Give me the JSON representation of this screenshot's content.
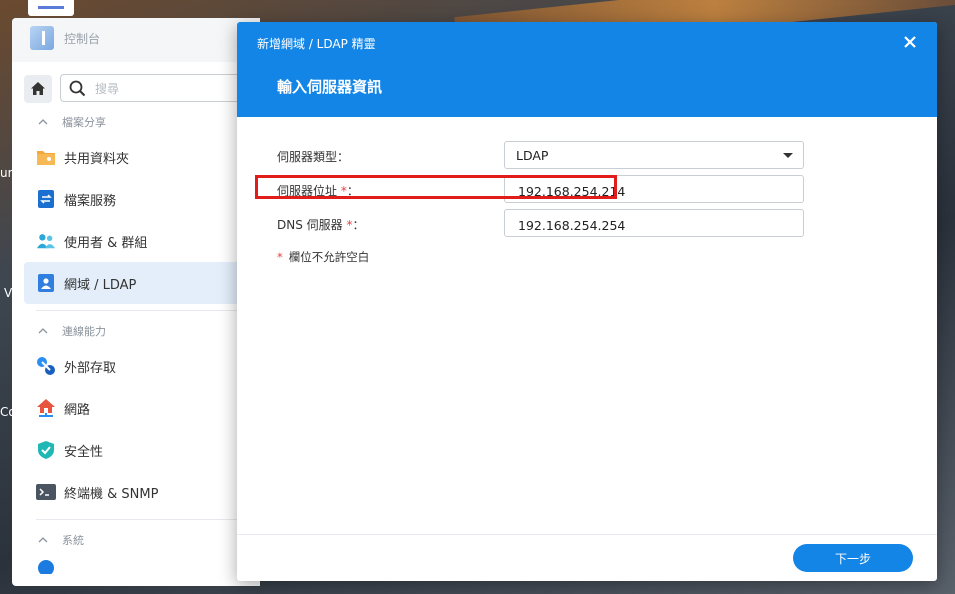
{
  "desktop": {
    "side_labels": [
      "un",
      "V",
      "Co"
    ]
  },
  "control_panel": {
    "title": "控制台",
    "search_placeholder": "搜尋",
    "sections": [
      {
        "label": "檔案分享",
        "items": [
          "共用資料夾",
          "檔案服務",
          "使用者 & 群組",
          "網域 / LDAP"
        ]
      },
      {
        "label": "連線能力",
        "items": [
          "外部存取",
          "網路",
          "安全性",
          "終端機 & SNMP"
        ]
      },
      {
        "label": "系統",
        "items": []
      }
    ],
    "active_item": "網域 / LDAP"
  },
  "wizard": {
    "title": "新增網域 / LDAP 精靈",
    "step_title": "輸入伺服器資訊",
    "fields": {
      "server_type": {
        "label": "伺服器類型：",
        "value": "LDAP"
      },
      "server_address": {
        "label": "伺服器位址",
        "value": "192.168.254.214"
      },
      "dns_server": {
        "label": "DNS 伺服器",
        "value": "192.168.254.254"
      }
    },
    "required_mark": "*",
    "required_suffix": "：",
    "note": "欄位不允許空白",
    "next_button": "下一步"
  },
  "colors": {
    "accent": "#1385e6",
    "required": "#e84040",
    "highlight": "#e21b1b"
  }
}
